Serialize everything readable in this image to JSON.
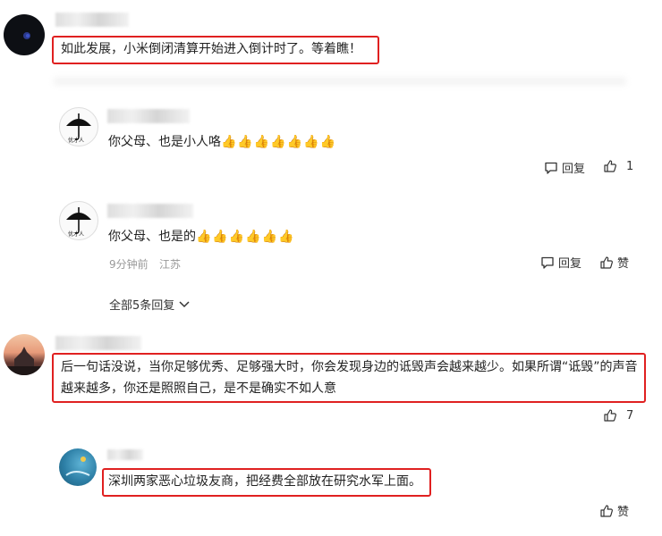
{
  "comments": [
    {
      "text": "如此发展，小米倒闭清算开始进入倒计时了。等着瞧！",
      "replies": [
        {
          "text": "你父母、也是小人咯",
          "emojis": "👍👍👍👍👍👍👍",
          "reply_label": "回复",
          "like_count": "1"
        },
        {
          "text": "你父母、也是的",
          "emojis": "👍👍👍👍👍👍",
          "time": "9分钟前",
          "location": "江苏",
          "reply_label": "回复",
          "like_label": "赞"
        }
      ],
      "view_all": "全部5条回复"
    },
    {
      "text": "后一句话没说，当你足够优秀、足够强大时，你会发现身边的诋毁声会越来越少。如果所谓“诋毁”的声音越来越多，你还是照照自己，是不是确实不如人意",
      "like_count": "7",
      "replies": [
        {
          "text": "深圳两家恶心垃圾友商，把经费全部放在研究水军上面。",
          "like_label": "赞"
        }
      ]
    }
  ],
  "colors": {
    "highlight": "#e02020",
    "meta": "#999999"
  },
  "icons": [
    "comment-icon",
    "thumbs-up-icon",
    "chevron-down-icon"
  ]
}
